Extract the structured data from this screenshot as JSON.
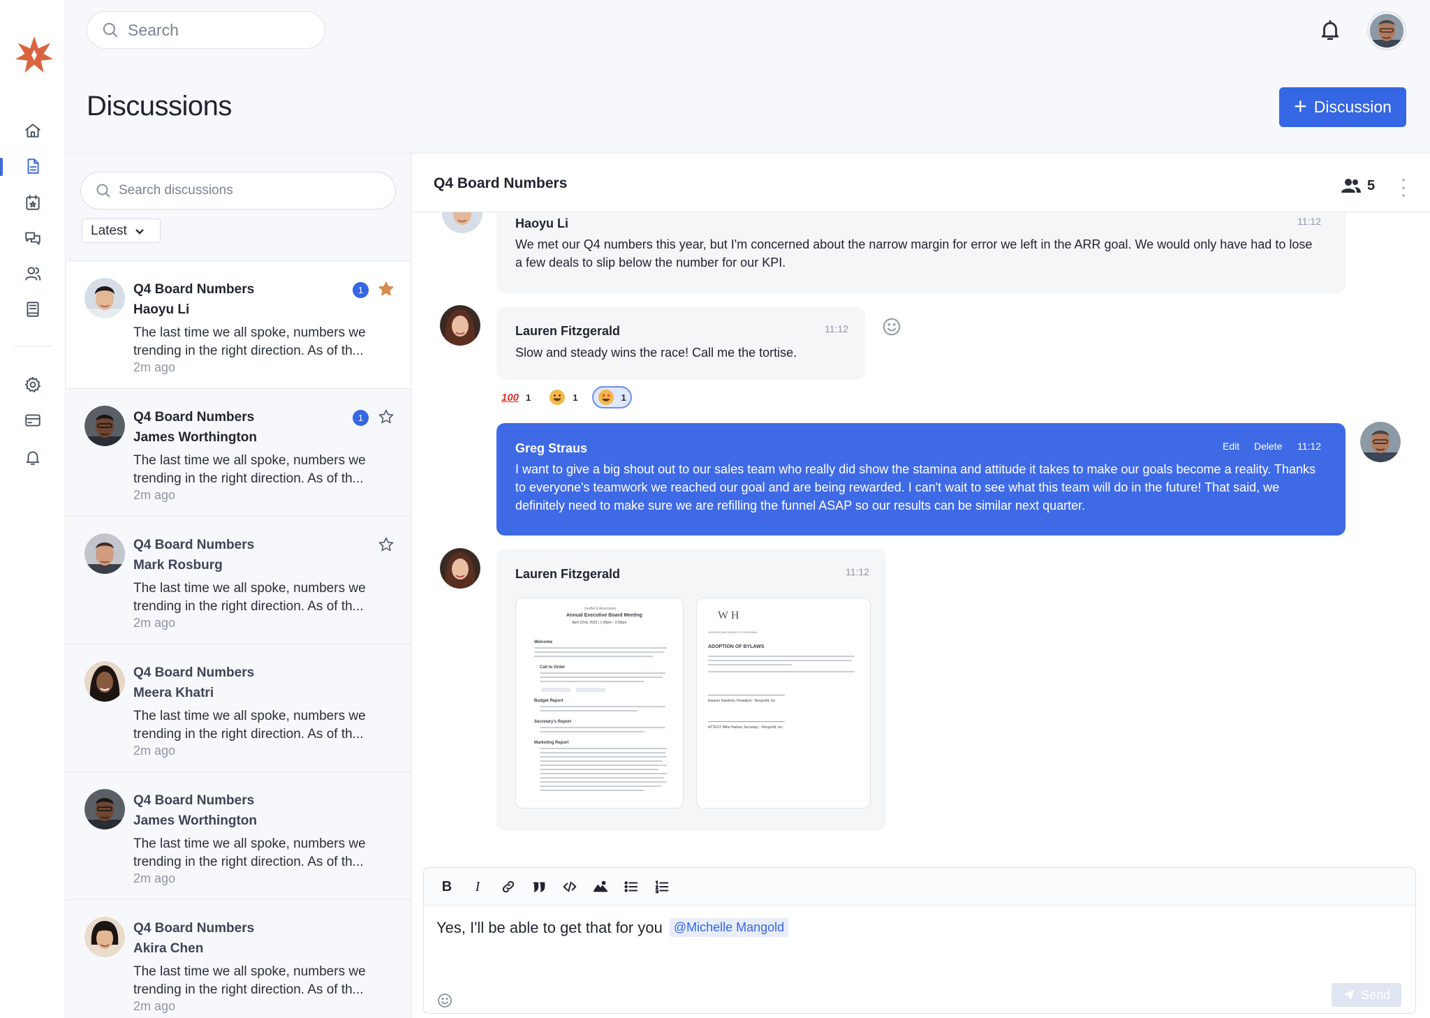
{
  "header": {
    "search_placeholder": "Search",
    "page_title": "Discussions",
    "new_discussion_label": "Discussion"
  },
  "sidebar": {
    "items": [
      {
        "icon": "home-icon"
      },
      {
        "icon": "document-icon",
        "active": true
      },
      {
        "icon": "calendar-icon"
      },
      {
        "icon": "chat-icon"
      },
      {
        "icon": "users-icon"
      },
      {
        "icon": "book-icon"
      },
      {
        "icon": "gear-icon"
      },
      {
        "icon": "credit-card-icon"
      },
      {
        "icon": "bell-icon"
      }
    ]
  },
  "list": {
    "search_placeholder": "Search discussions",
    "sort_label": "Latest",
    "threads": [
      {
        "title": "Q4 Board Numbers",
        "author": "Haoyu Li",
        "preview": "The last time we all spoke, numbers we trending in the right direction. As of th...",
        "time": "2m ago",
        "badge": "1",
        "starred": true
      },
      {
        "title": "Q4 Board Numbers",
        "author": "James Worthington",
        "preview": "The last time we all spoke, numbers we trending in the right direction. As of th...",
        "time": "2m ago",
        "badge": "1",
        "starred": false
      },
      {
        "title": "Q4 Board Numbers",
        "author": "Mark Rosburg",
        "preview": "The last time we all spoke, numbers we trending in the right direction. As of th...",
        "time": "2m ago",
        "starred": false
      },
      {
        "title": "Q4 Board Numbers",
        "author": "Meera Khatri",
        "preview": "The last time we all spoke, numbers we trending in the right direction. As of th...",
        "time": "2m ago"
      },
      {
        "title": "Q4 Board Numbers",
        "author": "James Worthington",
        "preview": "The last time we all spoke, numbers we trending in the right direction. As of th...",
        "time": "2m ago"
      },
      {
        "title": "Q4 Board Numbers",
        "author": "Akira Chen",
        "preview": "The last time we all spoke, numbers we trending in the right direction. As of th...",
        "time": "2m ago"
      }
    ]
  },
  "chat": {
    "title": "Q4 Board Numbers",
    "member_count": "5",
    "messages": [
      {
        "author": "Haoyu Li",
        "time": "11:12",
        "text_line1": "We met our Q4 numbers this year, but I'm concerned about the narrow margin for error we left in the ARR goal. We would only have had to lose",
        "text_line2": "a few deals to slip below the number for our KPI."
      },
      {
        "author": "Lauren Fitzgerald",
        "time": "11:12",
        "text": "Slow and steady wins the race! Call me the tortise."
      },
      {
        "author": "Greg Straus",
        "time": "11:12",
        "edit_label": "Edit",
        "delete_label": "Delete",
        "text_line1": "I want to give a big shout out to our sales team who really did show the stamina and attitude it takes to make our goals become a reality. Thanks",
        "text_line2": "to everyone's teamwork we reached our goal and are being rewarded. I can't wait to see what this team will do in the future! That said, we",
        "text_line3": "definitely need to make sure we are refilling the funnel ASAP so our results can be similar next quarter."
      },
      {
        "author": "Lauren Fitzgerald",
        "time": "11:12"
      }
    ],
    "reactions": [
      {
        "emoji": "100",
        "count": "1"
      },
      {
        "emoji": "grinning-face",
        "count": "1"
      },
      {
        "emoji": "star-struck",
        "count": "1",
        "selected": true
      }
    ],
    "attachments": [
      {
        "org": "Graffel & Associates",
        "title": "Annual Executive Board Meeting",
        "date": "April 22nd, 2022 | 1:00pm - 3:00pm",
        "sections": [
          "Welcome",
          "Call to Order",
          "Budget Report",
          "Secretary's Report",
          "Marketing Report"
        ]
      },
      {
        "logo": "W H",
        "org": "WHOLESOME HARVEST FOOD BANK",
        "title": "ADOPTION OF BYLAWS",
        "sig1": "Eleanor Hamilton, President - Nonprofit, Inc.",
        "sig2": "ATTEST: Mike Harlow, Secretary - Nonprofit, Inc."
      }
    ]
  },
  "composer": {
    "text": "Yes, I'll be able to get that for you",
    "mention": "@Michelle Mangold",
    "send_label": "Send",
    "tools": [
      "bold",
      "italic",
      "link",
      "quote",
      "code",
      "image",
      "bulleted-list",
      "numbered-list"
    ]
  }
}
